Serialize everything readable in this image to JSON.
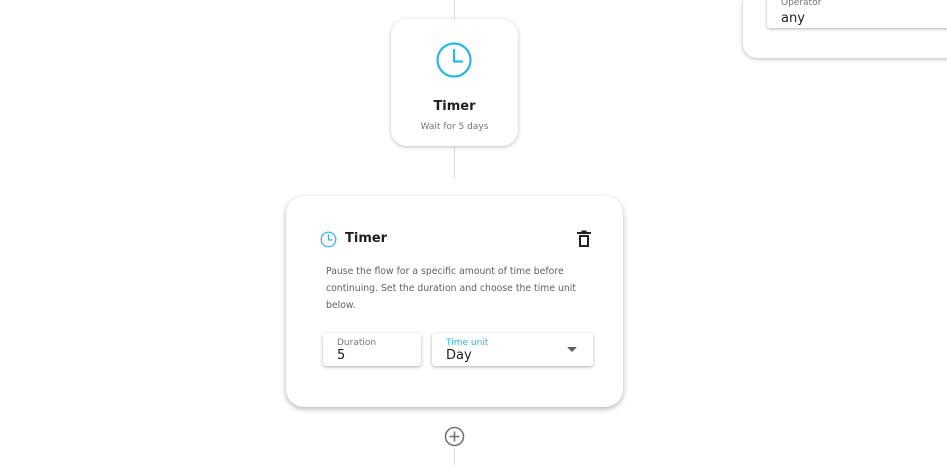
{
  "side_card": {
    "operator_label": "Operator",
    "operator_value": "any"
  },
  "timer_node": {
    "icon": "clock-icon",
    "title": "Timer",
    "subtitle": "Wait for 5 days"
  },
  "timer_editor": {
    "icon": "clock-icon",
    "title": "Timer",
    "delete_icon": "trash-icon",
    "description": "Pause the flow for a specific amount of time before continuing. Set the duration and choose the time unit below.",
    "duration": {
      "label": "Duration",
      "value": "5"
    },
    "time_unit": {
      "label": "Time unit",
      "value": "Day"
    }
  },
  "add_step": {
    "icon": "plus-circle-icon"
  },
  "colors": {
    "accent": "#29b6e6",
    "connector": "#dcdcdc",
    "text_primary": "#212121",
    "text_secondary": "#757575"
  }
}
